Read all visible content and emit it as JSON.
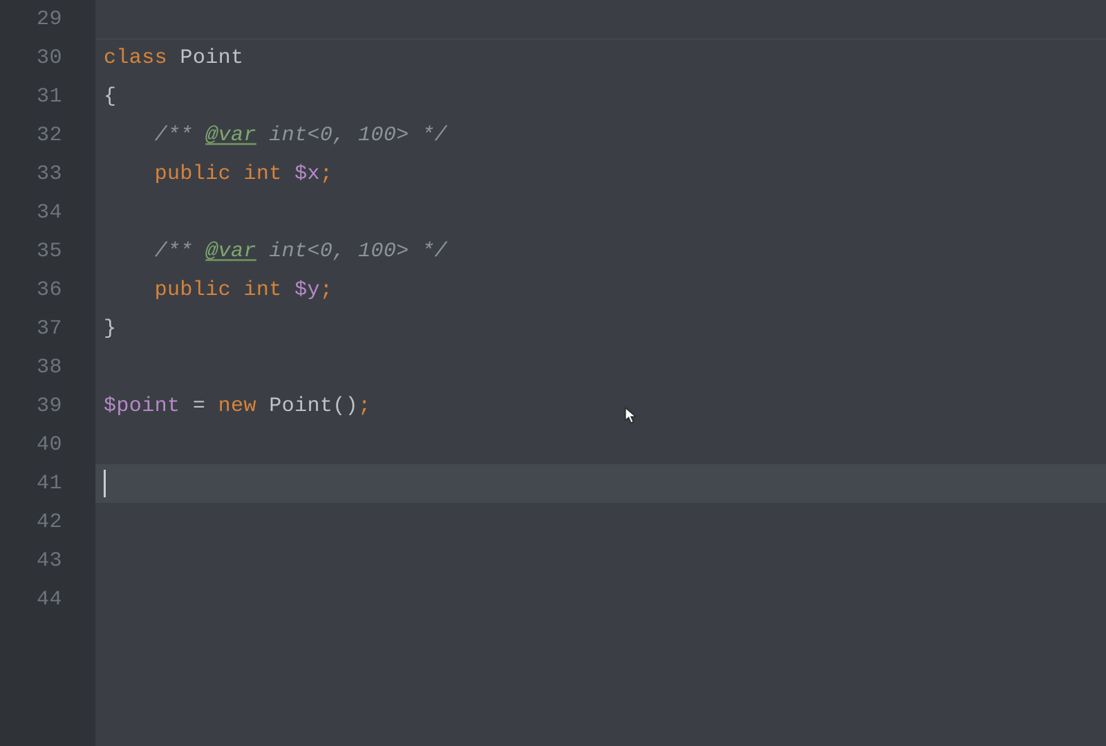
{
  "gutter": {
    "start": 29,
    "end": 44
  },
  "cursorLine": 41,
  "lines": {
    "29": {
      "tokens": []
    },
    "30": {
      "topBorder": true,
      "tokens": [
        {
          "cls": "kw-class",
          "t": "class"
        },
        {
          "cls": "",
          "t": " "
        },
        {
          "cls": "classname",
          "t": "Point"
        }
      ]
    },
    "31": {
      "tokens": [
        {
          "cls": "brace",
          "t": "{"
        }
      ]
    },
    "32": {
      "indent": 1,
      "tokens": [
        {
          "cls": "comment",
          "t": "/** "
        },
        {
          "cls": "doctag",
          "t": "@var"
        },
        {
          "cls": "comment",
          "t": " int<0, 100> */"
        }
      ]
    },
    "33": {
      "indent": 1,
      "tokens": [
        {
          "cls": "kw-mod",
          "t": "public"
        },
        {
          "cls": "",
          "t": " "
        },
        {
          "cls": "kw-type",
          "t": "int"
        },
        {
          "cls": "",
          "t": " "
        },
        {
          "cls": "var",
          "t": "$x"
        },
        {
          "cls": "semi",
          "t": ";"
        }
      ]
    },
    "34": {
      "tokens": []
    },
    "35": {
      "indent": 1,
      "tokens": [
        {
          "cls": "comment",
          "t": "/** "
        },
        {
          "cls": "doctag",
          "t": "@var"
        },
        {
          "cls": "comment",
          "t": " int<0, 100> */"
        }
      ]
    },
    "36": {
      "indent": 1,
      "tokens": [
        {
          "cls": "kw-mod",
          "t": "public"
        },
        {
          "cls": "",
          "t": " "
        },
        {
          "cls": "kw-type",
          "t": "int"
        },
        {
          "cls": "",
          "t": " "
        },
        {
          "cls": "var",
          "t": "$y"
        },
        {
          "cls": "semi",
          "t": ";"
        }
      ]
    },
    "37": {
      "tokens": [
        {
          "cls": "brace",
          "t": "}"
        }
      ]
    },
    "38": {
      "tokens": []
    },
    "39": {
      "tokens": [
        {
          "cls": "var",
          "t": "$point"
        },
        {
          "cls": "",
          "t": " "
        },
        {
          "cls": "op",
          "t": "="
        },
        {
          "cls": "",
          "t": " "
        },
        {
          "cls": "kw-new",
          "t": "new"
        },
        {
          "cls": "",
          "t": " "
        },
        {
          "cls": "classname",
          "t": "Point"
        },
        {
          "cls": "punct",
          "t": "()"
        },
        {
          "cls": "semi",
          "t": ";"
        }
      ]
    },
    "40": {
      "tokens": []
    },
    "41": {
      "current": true,
      "caret": true,
      "tokens": []
    },
    "42": {
      "tokens": []
    },
    "43": {
      "tokens": []
    },
    "44": {
      "tokens": []
    }
  }
}
